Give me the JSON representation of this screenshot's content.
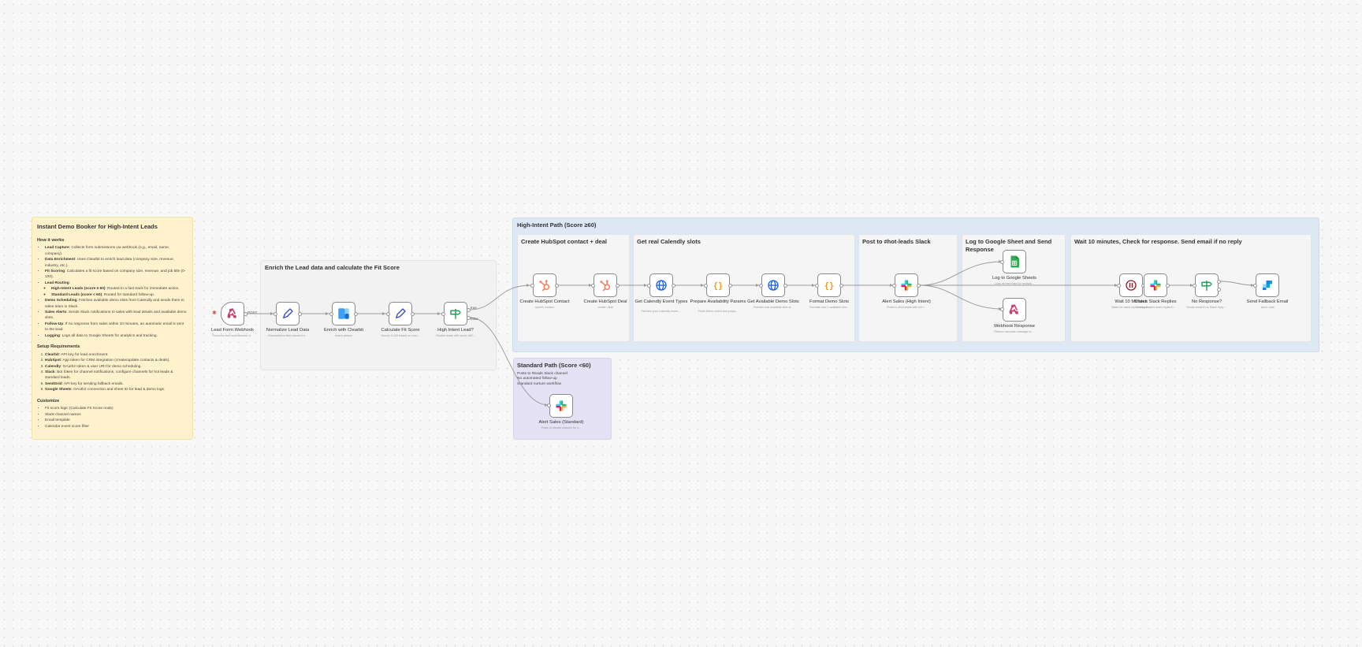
{
  "main_note": {
    "title": "Instant Demo Booker for High-Intent Leads",
    "how_heading": "How it works",
    "how_items": [
      {
        "bold": "Lead Capture",
        "text": ": Collects form submissions via webhook (e.g., email, name, company)."
      },
      {
        "bold": "Data Enrichment",
        "text": ": Uses Clearbit to enrich lead data (company size, revenue, industry, etc.)."
      },
      {
        "bold": "Fit Scoring",
        "text": ": Calculates a fit score based on company size, revenue, and job title (0-100)."
      },
      {
        "bold": "Lead Routing",
        "text": ":"
      },
      {
        "bold": "High-Intent Leads (score ≥ 60)",
        "text": ": Routed to a fast track for immediate action.",
        "sub": true
      },
      {
        "bold": "Standard Leads (score < 60)",
        "text": ": Routed for standard follow-up.",
        "sub": true
      },
      {
        "bold": "Demo Scheduling",
        "text": ": Fetches available demo slots from Calendly and sends them to sales team in Slack."
      },
      {
        "bold": "Sales Alerts",
        "text": ": Sends Slack notifications to sales with lead details and available demo slots."
      },
      {
        "bold": "Follow-Up",
        "text": ": If no response from sales within 10 minutes, an automatic email is sent to the lead."
      },
      {
        "bold": "Logging",
        "text": ": Logs all data to Google Sheets for analytics and tracking."
      }
    ],
    "setup_heading": "Setup Requirements",
    "setup_items": [
      {
        "bold": "Clearbit",
        "text": ": API key for lead enrichment."
      },
      {
        "bold": "HubSpot",
        "text": ": App token for CRM integration (create/update contacts & deals)."
      },
      {
        "bold": "Calendly",
        "text": ": OAuth2 token & user URI for demo scheduling."
      },
      {
        "bold": "Slack",
        "text": ": Bot token for channel notifications, configure channels for hot leads & standard leads."
      },
      {
        "bold": "SendGrid",
        "text": ": API key for sending fallback emails."
      },
      {
        "bold": "Google Sheets",
        "text": ": OAuth2 connection and sheet ID for lead & demo logs."
      }
    ],
    "customize_heading": "Customize",
    "customize_items": [
      "Fit score logic (Calculate Fit Score node)",
      "Slack channel names",
      "Email template",
      "Calendar event score filter"
    ]
  },
  "sections": {
    "enrich": "Enrich the Lead data and calculate the Fit Score",
    "high_intent": "High-Intent Path (Score ≥60)",
    "hubspot": "Create HubSpot contact + deal",
    "calendly": "Get real Calendly slots",
    "slack": "Post to #hot-leads Slack",
    "sheets": "Log to Google Sheet and Send Response",
    "wait": "Wait 10 minutes, Check for response. Send email if no reply",
    "standard": "Standard Path (Score <60)",
    "standard_body": "Posts to #leads Slack channel\nNo automated follow-up\nStandard nurture workflow"
  },
  "nodes": {
    "webhook": {
      "label": "Lead Form Webhook",
      "sub": "Receives lead submissions vi..."
    },
    "normalize": {
      "label": "Normalize Lead Data",
      "sub": "Standardizes field names fro..."
    },
    "clearbit": {
      "label": "Enrich with Clearbit",
      "sub": "enrich person"
    },
    "fit": {
      "label": "Calculate Fit Score",
      "sub": "Scores 0-100 based on roun..."
    },
    "ifnode": {
      "label": "High Intent Lead?",
      "sub": "Routes leads with score ≥60..."
    },
    "hs_contact": {
      "label": "Create HubSpot Contact",
      "sub": "upsert: contact"
    },
    "hs_deal": {
      "label": "Create HubSpot Deal",
      "sub": "create: deal"
    },
    "cal_types": {
      "label": "Get Calendly Event Types",
      "sub": "Fetches your Calendly event ..."
    },
    "prep_params": {
      "label": "Prepare Availability Params",
      "sub": "Finds Demo event and prepa..."
    },
    "get_slots": {
      "label": "Get Available Demo Slots",
      "sub": "Fetches real available time sl..."
    },
    "format_slots": {
      "label": "Format Demo Slots",
      "sub": "Formats next 3 available slot..."
    },
    "slack_high": {
      "label": "Alert Sales (High Intent)",
      "sub": "Posts to #hot-leads with full l..."
    },
    "sheets": {
      "label": "Log to Google Sheets",
      "sub": "Logs all lead data for analytic..."
    },
    "respond": {
      "label": "Webhook Response",
      "sub": "Returns success message to ..."
    },
    "wait": {
      "label": "Wait 10 Minutes",
      "sub": "Waits for sales rep to respon..."
    },
    "check_replies": {
      "label": "Check Slack Replies",
      "sub": "Checks if sales team replied t..."
    },
    "no_response": {
      "label": "No Response?",
      "sub": "Sends email if no Slack reply ..."
    },
    "fallback": {
      "label": "Send Fallback Email",
      "sub": "send: mail"
    },
    "slack_std": {
      "label": "Alert Sales (Standard)",
      "sub": "Posts to #leads channel for s..."
    }
  },
  "edge_labels": {
    "post": "POST",
    "true": "true",
    "false": "false"
  },
  "colors": {
    "main_note": "#fff2cc",
    "high_intent_bg": "#dde8f4",
    "standard_bg": "#e6e2f5",
    "section_bg": "#f5f5f5",
    "hubspot": "#ff7a59",
    "calendly": "#1a62e6",
    "code": "#f39c12",
    "clearbit": "#3ea0f5",
    "sheets": "#34a853",
    "webhook": "#c83e6e",
    "if": "#26a15a",
    "wait": "#9b1b30",
    "edit": "#3a4cc0"
  }
}
